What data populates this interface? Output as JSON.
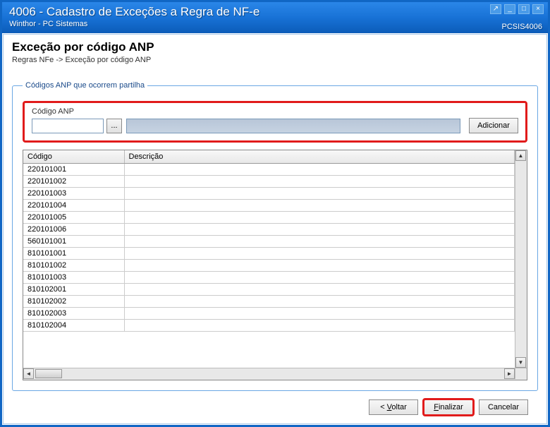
{
  "titlebar": {
    "title": "4006 - Cadastro de Exceções a Regra de NF-e",
    "subtitle": "Winthor - PC Sistemas",
    "sysid": "PCSIS4006"
  },
  "page": {
    "heading": "Exceção por código ANP",
    "breadcrumb": "Regras NFe -> Exceção por código ANP"
  },
  "group": {
    "legend": "Códigos ANP que ocorrem partilha",
    "input_label": "Código ANP",
    "lookup_label": "...",
    "add_label": "Adicionar"
  },
  "grid": {
    "columns": [
      "Código",
      "Descrição"
    ],
    "rows": [
      {
        "codigo": "220101001",
        "descricao": ""
      },
      {
        "codigo": "220101002",
        "descricao": ""
      },
      {
        "codigo": "220101003",
        "descricao": ""
      },
      {
        "codigo": "220101004",
        "descricao": ""
      },
      {
        "codigo": "220101005",
        "descricao": ""
      },
      {
        "codigo": "220101006",
        "descricao": ""
      },
      {
        "codigo": "560101001",
        "descricao": ""
      },
      {
        "codigo": "810101001",
        "descricao": ""
      },
      {
        "codigo": "810101002",
        "descricao": ""
      },
      {
        "codigo": "810101003",
        "descricao": ""
      },
      {
        "codigo": "810102001",
        "descricao": ""
      },
      {
        "codigo": "810102002",
        "descricao": ""
      },
      {
        "codigo": "810102003",
        "descricao": ""
      },
      {
        "codigo": "810102004",
        "descricao": ""
      }
    ]
  },
  "footer": {
    "back_prefix": "< ",
    "back_u": "V",
    "back_rest": "oltar",
    "finish_u": "F",
    "finish_rest": "inalizar",
    "cancel": "Cancelar"
  }
}
